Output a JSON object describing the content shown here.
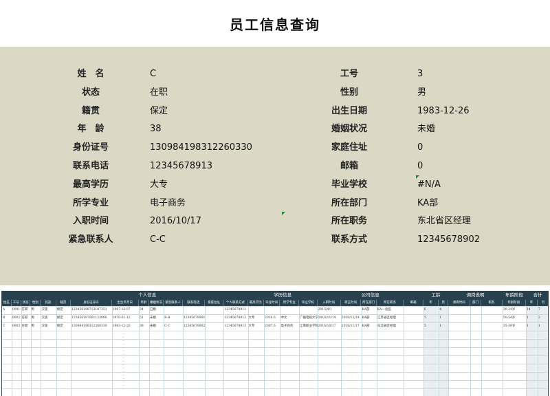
{
  "page": {
    "title": "员工信息查询"
  },
  "form": {
    "left": [
      {
        "label": "姓　名",
        "value": "C"
      },
      {
        "label": "状态",
        "value": "在职"
      },
      {
        "label": "籍贯",
        "value": "保定"
      },
      {
        "label": "年　龄",
        "value": "38"
      },
      {
        "label": "身份证号",
        "value": "130984198312260330"
      },
      {
        "label": "联系电话",
        "value": "12345678913"
      },
      {
        "label": "最高学历",
        "value": "大专"
      },
      {
        "label": "所学专业",
        "value": "电子商务"
      },
      {
        "label": "入职时间",
        "value": "2016/10/17"
      },
      {
        "label": "紧急联系人",
        "value": "C-C"
      }
    ],
    "right": [
      {
        "label": "工号",
        "value": "3"
      },
      {
        "label": "性别",
        "value": "男"
      },
      {
        "label": "出生日期",
        "value": "1983-12-26"
      },
      {
        "label": "婚姻状况",
        "value": "未婚"
      },
      {
        "label": "家庭住址",
        "value": "0"
      },
      {
        "label": "邮箱",
        "value": "0"
      },
      {
        "label": "毕业学校",
        "value": "#N/A"
      },
      {
        "label": "所在部门",
        "value": "KA部"
      },
      {
        "label": "所在职务",
        "value": "东北省区经理"
      },
      {
        "label": "联系方式",
        "value": "12345678902"
      }
    ]
  },
  "sheet": {
    "groups": [
      "个人信息",
      "学历信息",
      "公司信息",
      "工龄",
      "调岗说明",
      "年龄阶段",
      "合计"
    ],
    "headers": [
      "姓名",
      "工号",
      "状态",
      "性别",
      "民族",
      "籍贯",
      "身份证号码",
      "出生年月日",
      "年龄",
      "婚姻状况",
      "紧急联系人",
      "联系电话",
      "家庭住址",
      "个人联系方式",
      "最高学历",
      "毕业时间",
      "所学专业",
      "毕业学校",
      "入职时间",
      "转正时间",
      "所在部门",
      "所在职务",
      "邮箱",
      "年",
      "月",
      "调岗时间",
      "部门",
      "职务",
      "年龄阶段",
      "年",
      "月"
    ],
    "rows": [
      [
        "A",
        "0001",
        "在职",
        "男",
        "汉族",
        "保定",
        "123456198712187351",
        "1987-12-07",
        "34",
        "已婚",
        "",
        "",
        "",
        "12345678911",
        "",
        "",
        "",
        "",
        "2015/4/1",
        "",
        "KA部",
        "KA一总监",
        "",
        "6",
        "4",
        "",
        "",
        "",
        "30-34岁",
        "14",
        "7"
      ],
      [
        "B",
        "0002",
        "在职",
        "男",
        "汉族",
        "保定",
        "123456197001123006",
        "1970-01-12",
        "51",
        "未婚",
        "B-B",
        "12345678901",
        "",
        "12345678912",
        "大专",
        "2016.6",
        "中文",
        "广播电视大学",
        "2016/11/14",
        "2016/12/14",
        "KA部",
        "江苏省区经理",
        "",
        "5",
        "1",
        "",
        "",
        "",
        "50-54岁",
        "1",
        "2"
      ],
      [
        "C",
        "0003",
        "在职",
        "男",
        "汉族",
        "保定",
        "130984198312260330",
        "1983-12-26",
        "38",
        "未婚",
        "C-C",
        "12345678902",
        "",
        "12345678913",
        "大专",
        "2007.6",
        "电子商务",
        "江南职业学院",
        "2016/10/17",
        "2016/11/17",
        "KA部",
        "东北省区经理",
        "",
        "5",
        "1",
        "",
        "",
        "",
        "35-39岁",
        "1",
        "1"
      ]
    ]
  }
}
